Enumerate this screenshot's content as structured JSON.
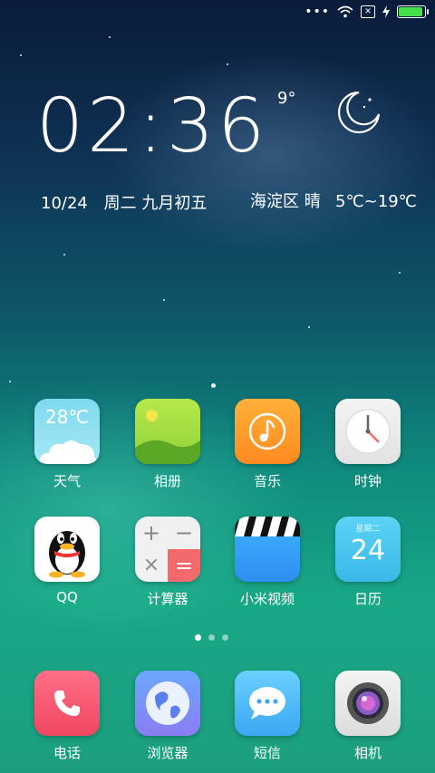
{
  "status_bar": {
    "more": "•••",
    "sim_label": "✕",
    "battery_color": "#45e04a"
  },
  "widget": {
    "time": "02:36",
    "date": "10/24",
    "weekday_lunar": "周二 九月初五",
    "temp_now": "9°",
    "location_weather": "海淀区 晴",
    "temp_range": "5℃~19℃",
    "weather_icon": "moon-icon"
  },
  "apps": [
    {
      "label": "天气",
      "icon": "weather-icon",
      "text": "28℃"
    },
    {
      "label": "相册",
      "icon": "gallery-icon"
    },
    {
      "label": "音乐",
      "icon": "music-icon"
    },
    {
      "label": "时钟",
      "icon": "clock-icon"
    },
    {
      "label": "QQ",
      "icon": "qq-penguin-icon"
    },
    {
      "label": "计算器",
      "icon": "calculator-icon"
    },
    {
      "label": "小米视频",
      "icon": "video-icon"
    },
    {
      "label": "日历",
      "icon": "calendar-icon",
      "weekday": "星期二",
      "day": "24"
    }
  ],
  "pager": {
    "pages": 3,
    "current": 0
  },
  "dock": [
    {
      "label": "电话",
      "icon": "phone-icon"
    },
    {
      "label": "浏览器",
      "icon": "browser-icon"
    },
    {
      "label": "短信",
      "icon": "sms-icon"
    },
    {
      "label": "相机",
      "icon": "camera-icon"
    }
  ]
}
